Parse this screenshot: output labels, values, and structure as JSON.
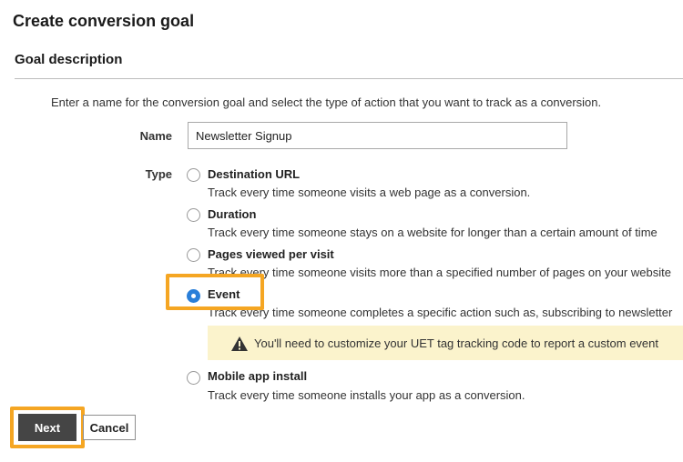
{
  "page": {
    "title": "Create conversion goal",
    "section_title": "Goal description",
    "intro": "Enter a name for the conversion goal and select the type of action that you want to track as a conversion."
  },
  "form": {
    "name_label": "Name",
    "name_value": "Newsletter Signup",
    "type_label": "Type",
    "options": [
      {
        "label": "Destination URL",
        "description": "Track every time someone visits a web page as a conversion.",
        "checked": false
      },
      {
        "label": "Duration",
        "description": "Track every time someone stays on a website for longer than a certain amount of time",
        "checked": false
      },
      {
        "label": "Pages viewed per visit",
        "description": "Track every time someone visits more than a specified number of pages on your website",
        "checked": false
      },
      {
        "label": "Event",
        "description": "Track every time someone completes a specific action such as, subscribing to newsletter",
        "checked": true
      },
      {
        "label": "Mobile app install",
        "description": "Track every time someone installs your app as a conversion.",
        "checked": false
      }
    ],
    "warning": "You'll need to customize your UET tag tracking code to report a custom event"
  },
  "actions": {
    "next_label": "Next",
    "cancel_label": "Cancel"
  },
  "colors": {
    "highlight": "#f5a623",
    "radio_selected": "#2a7fd9",
    "warning_bg": "#fbf3cc",
    "next_bg": "#454545"
  },
  "icons": {
    "warning": "warning-triangle-icon"
  }
}
